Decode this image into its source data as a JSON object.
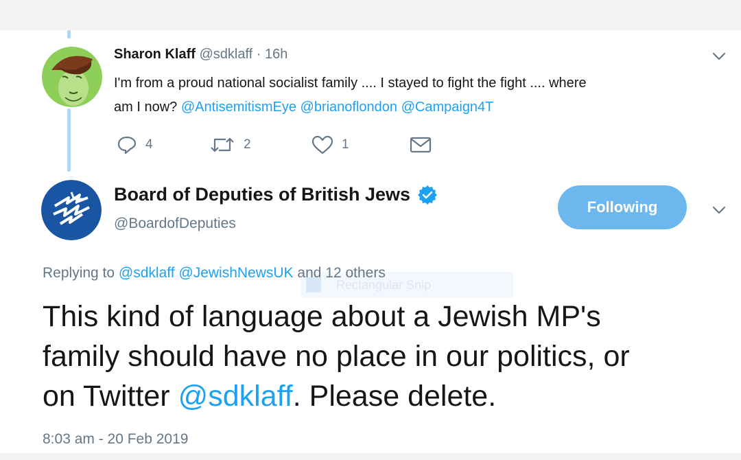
{
  "reply_tweet": {
    "display_name": "Sharon Klaff",
    "handle": "@sdklaff",
    "time_separator": "·",
    "time": "16h",
    "text_line1": "I'm from a proud national socialist family .... I stayed to fight the fight .... where",
    "text_line2_plain": "am I now?",
    "mentions": [
      "@AntisemitismEye",
      "@brianoflondon",
      "@Campaign4T"
    ],
    "reply_count": "4",
    "retweet_count": "2",
    "like_count": "1",
    "avatar_icon": "cartoon-avatar",
    "more_icon": "chevron-down-icon"
  },
  "main_tweet": {
    "display_name": "Board of Deputies of British Jews",
    "verified_icon": "verified-badge-icon",
    "handle": "@BoardofDeputies",
    "follow_label": "Following",
    "replying_prefix": "Replying to",
    "replying_mentions": "@sdklaff @JewishNewsUK",
    "replying_suffix": "and 12 others",
    "ghost_text": "Rectangular Snip",
    "body_line1": "This kind of language about a Jewish MP's",
    "body_line2": "family should have no place in our politics, or",
    "body_line3_pre": "on Twitter",
    "body_mention": "@sdklaff",
    "body_line3_post": ". Please delete.",
    "timestamp": "8:03 am - 20 Feb 2019"
  },
  "colors": {
    "accent": "#1da1f2",
    "follow_button": "#6cb7ee",
    "muted_text": "#657786",
    "thread_line": "#b3d7f0",
    "logo_blue": "#1a55a3"
  }
}
